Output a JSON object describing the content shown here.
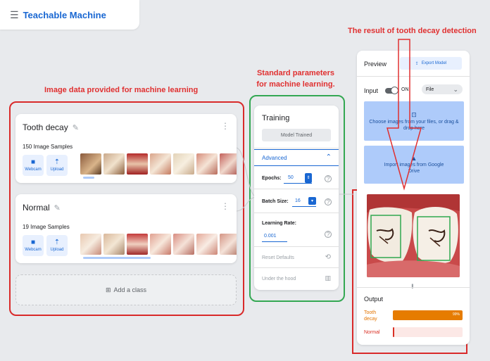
{
  "app": {
    "title": "Teachable Machine",
    "menu_icon": "hamburger-menu-icon"
  },
  "annotations": {
    "image_data": "Image data provided for machine learning",
    "standard_params": "Standard parameters for machine learning.",
    "result": "The result of tooth decay detection"
  },
  "classes": [
    {
      "name": "Tooth decay",
      "samples": "150 Image Samples",
      "webcam": "Webcam",
      "upload": "Upload"
    },
    {
      "name": "Normal",
      "samples": "19 Image Samples",
      "webcam": "Webcam",
      "upload": "Upload"
    }
  ],
  "add_class": "Add a class",
  "training": {
    "title": "Training",
    "model_button": "Model Trained",
    "advanced": "Advanced",
    "epochs_label": "Epochs:",
    "epochs_value": "50",
    "batch_label": "Batch Size:",
    "batch_value": "16",
    "lr_label": "Learning Rate:",
    "lr_value": "0.001",
    "reset": "Reset Defaults",
    "under_hood": "Under the hood"
  },
  "preview": {
    "title": "Preview",
    "export": "Export Model",
    "input_label": "Input",
    "toggle_state": "ON",
    "source": "File",
    "choose_text": "Choose images from your files, or drag & drop here",
    "drive_text": "Import images from Google Drive",
    "output_label": "Output",
    "results": [
      {
        "label": "Tooth decay",
        "percent": 100,
        "percent_label": "99%"
      },
      {
        "label": "Normal",
        "percent": 1,
        "percent_label": ""
      }
    ]
  },
  "colors": {
    "accent": "#1967d2",
    "annotation_red": "#d92a2a",
    "annotation_green": "#34a853",
    "bar_orange": "#e67c00",
    "bar_pink": "#fce8e6"
  }
}
